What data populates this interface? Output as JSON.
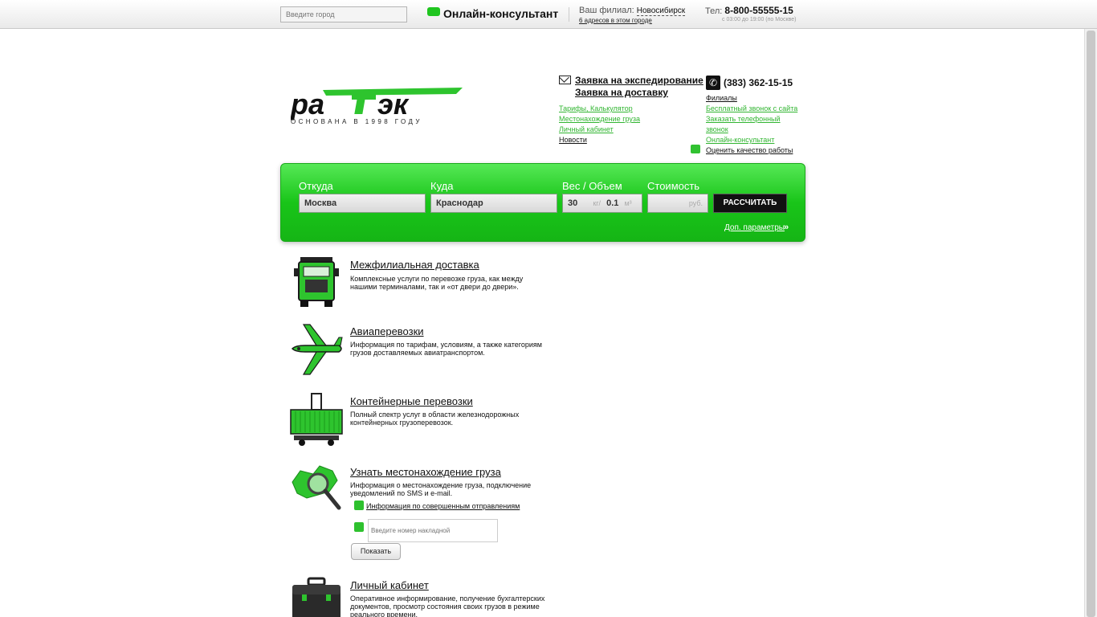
{
  "topbar": {
    "city_placeholder": "Введите город",
    "consult_label": "Онлайн-консультант",
    "branch_label": "Ваш филиал:",
    "branch_city": "Новосибирск",
    "branch_addresses": "6 адресов в этом городе",
    "phone_label": "Тел:",
    "phone_number": "8-800-55555-15",
    "phone_hours": "с 03:00 до 19:00 (по Москве)"
  },
  "logo": {
    "brand": "раТэк",
    "tagline": "ОСНОВАНА В 1998 ГОДУ",
    "accent": "#31c231"
  },
  "header_links": {
    "request_expedition": "Заявка на экспедирование",
    "request_delivery": "Заявка на доставку",
    "tariffs": "Тарифы, Калькулятор",
    "tracking": "Местонахождение груза",
    "cabinet": "Личный кабинет",
    "news": "Новости",
    "phone_main": "(383) 362-15-15",
    "branches": "Филиалы",
    "free_call": "Бесплатный звонок с сайта",
    "order_call_1": "Заказать телефонный",
    "order_call_2": "звонок",
    "online_consult": "Онлайн-консультант",
    "rate_quality": "Оценить качество работы"
  },
  "calculator": {
    "from_label": "Откуда",
    "from_value": "Москва",
    "to_label": "Куда",
    "to_value": "Краснодар",
    "weight_label": "Вес / Объем",
    "weight_value": "30",
    "weight_unit": "кг",
    "volume_value": "0.1",
    "volume_unit": "м³",
    "cost_label": "Стоимость",
    "cost_unit": "руб.",
    "calc_button": "РАССЧИТАТЬ",
    "more_params": "Доп. параметры",
    "more_arrow": "»"
  },
  "services": [
    {
      "title": "Межфилиальная доставка",
      "desc": "Комплексные услуги по перевозке груза, как между нашими терминалами, так и «от двери до двери».",
      "icon": "truck-icon"
    },
    {
      "title": "Авиаперевозки",
      "desc": "Информация по тарифам, условиям, а также категориям грузов доставляемых авиатранспортом.",
      "icon": "airplane-icon"
    },
    {
      "title": "Контейнерные перевозки",
      "desc": "Полный спектр услуг в области железнодорожных контейнерных грузоперевозок.",
      "icon": "container-icon"
    },
    {
      "title": "Узнать местонахождение груза",
      "desc": "Информация о местонахождение груза, подключение уведомлений по SMS и e-mail.",
      "icon": "map-magnifier-icon"
    },
    {
      "title": "Личный кабинет",
      "desc": "Оперативное информирование, получение бухгалтерских документов, просмотр состояния своих грузов в режиме реального времени.",
      "icon": "briefcase-icon"
    }
  ],
  "tracking": {
    "info_link": "Информация по совершенным отправлениям",
    "input_placeholder": "Введите номер накладной",
    "show_button": "Показать"
  }
}
